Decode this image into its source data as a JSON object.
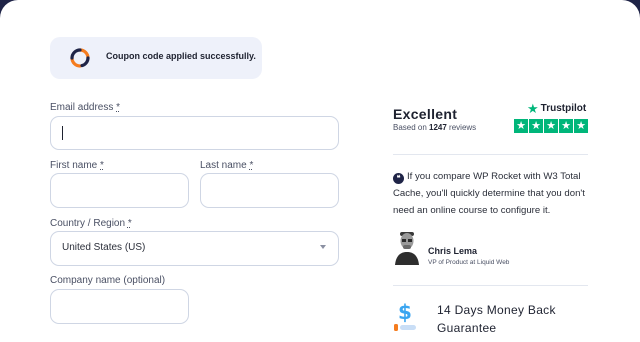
{
  "notice": {
    "message": "Coupon code applied successfully.",
    "colors": {
      "spinner_dark": "#1f2447",
      "spinner_orange": "#f57c1f",
      "background": "#eef1fa"
    }
  },
  "form": {
    "email": {
      "label": "Email address",
      "required_mark": "*",
      "value": ""
    },
    "first_name": {
      "label": "First name",
      "required_mark": "*",
      "value": ""
    },
    "last_name": {
      "label": "Last name",
      "required_mark": "*",
      "value": ""
    },
    "country": {
      "label": "Country / Region",
      "required_mark": "*",
      "selected": "United States (US)"
    },
    "company": {
      "label": "Company name (optional)",
      "value": ""
    }
  },
  "reviews": {
    "rating_word": "Excellent",
    "based_prefix": "Based on ",
    "count": "1247",
    "based_suffix": " reviews",
    "brand": "Trustpilot",
    "stars": 5,
    "star_color": "#00b67a"
  },
  "testimonial": {
    "quote": "If you compare WP Rocket with W3 Total Cache, you'll quickly determine that you don't need an online course to configure it.",
    "author": "Chris Lema",
    "role": "VP of Product at Liquid Web"
  },
  "guarantee": {
    "text": "14 Days Money Back Guarantee",
    "icon": "dollar-icon",
    "colors": {
      "dollar": "#3aa5f0",
      "bar_orange": "#f57c1f",
      "bar_blue": "#c9def6"
    }
  },
  "colors": {
    "page_bg": "#1f2447",
    "card_bg": "#ffffff",
    "field_border": "#cfd6e4"
  }
}
